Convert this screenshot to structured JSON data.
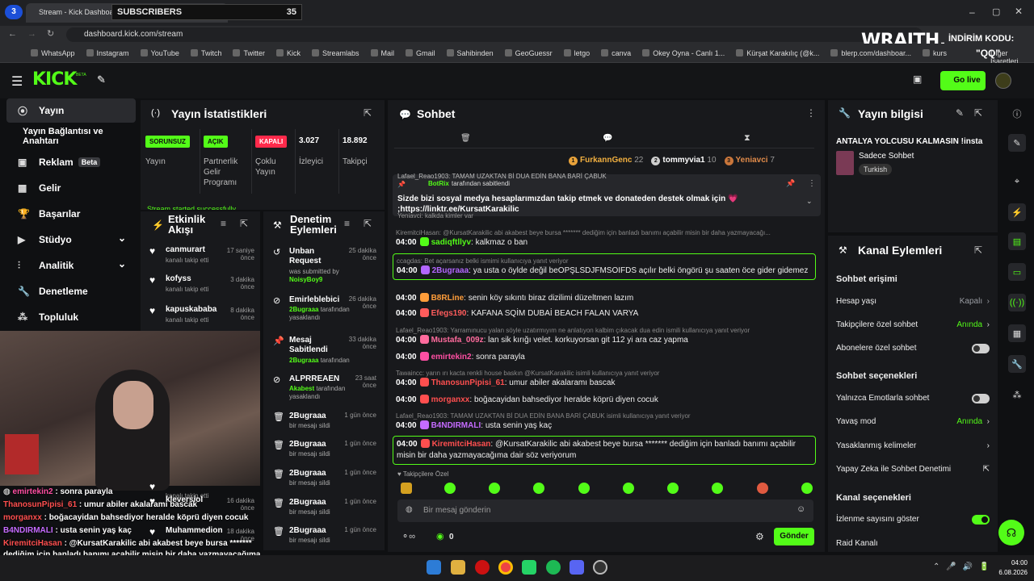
{
  "browser": {
    "tab_title": "Stream - Kick Dashboard",
    "tab_count": "3",
    "url": "dashboard.kick.com/stream",
    "bookmarks": [
      "WhatsApp",
      "Instagram",
      "YouTube",
      "Twitch",
      "Twitter",
      "Kick",
      "Streamlabs",
      "Mail",
      "Gmail",
      "Sahibinden",
      "GeoGuessr",
      "letgo",
      "canva",
      "Okey Oyna - Canlı 1...",
      "Kürşat Karakılıç (@k...",
      "blerp.com/dashboar...",
      "kurs"
    ],
    "other_bookmarks": "Diğer İşaretleri"
  },
  "overlay": {
    "subscribers_label": "SUBSCRIBERS",
    "subscribers_count": "35",
    "sponsor": "WRAITH.",
    "sponsor_code_label": "İNDİRİM KODU:",
    "sponsor_code": "\"QQ\""
  },
  "app": {
    "logo": "KICK",
    "logo_beta": "BETA",
    "go_live": "Go live"
  },
  "nav": {
    "items": [
      {
        "label": "Yayın",
        "icon": "broadcast-icon"
      },
      {
        "label": "Yayın Bağlantısı ve Anahtarı",
        "icon": ""
      },
      {
        "label": "Reklam",
        "icon": "ad-icon",
        "badge": "Beta"
      },
      {
        "label": "Gelir",
        "icon": "grid-icon"
      },
      {
        "label": "Başarılar",
        "icon": "trophy-icon"
      },
      {
        "label": "Stüdyo",
        "icon": "studio-icon"
      },
      {
        "label": "Analitik",
        "icon": "analytics-icon"
      },
      {
        "label": "Denetleme",
        "icon": "wrench-icon"
      },
      {
        "label": "Topluluk",
        "icon": "community-icon"
      }
    ]
  },
  "stats": {
    "title": "Yayın İstatistikleri",
    "cols": [
      {
        "pill": "SORUNSUZ",
        "label": "Yayın"
      },
      {
        "pill": "AÇIK",
        "label": "Partnerlik Gelir Programı"
      },
      {
        "pill": "KAPALI",
        "label": "Çoklu Yayın"
      },
      {
        "value": "3.027",
        "label": "İzleyici"
      },
      {
        "value": "18.892",
        "label": "Takipçi"
      }
    ],
    "banner": "Stream started successfully"
  },
  "activity": {
    "title": "Etkinlik Akışı",
    "items": [
      {
        "name": "canmurart",
        "sub": "kanalı takip etti",
        "time": "17 saniye önce"
      },
      {
        "name": "kofyss",
        "sub": "kanalı takip etti",
        "time": "3 dakika önce"
      },
      {
        "name": "kapuskababa",
        "sub": "kanalı takip etti",
        "time": "8 dakika önce"
      },
      {
        "name": "",
        "sub": "kanalı takip etti",
        "time": ""
      },
      {
        "name": "kleversiol",
        "sub": "",
        "time": "16 dakika önce"
      },
      {
        "name": "Muhammedion",
        "sub": "",
        "time": "18 dakika önce"
      }
    ]
  },
  "moderation": {
    "title": "Denetim Eylemleri",
    "items": [
      {
        "name": "Unban Request",
        "sub": "was submitted by",
        "user": "NoisyBoy9",
        "time": "25 dakika önce"
      },
      {
        "name": "Emirleblebici",
        "user": "2Bugraaa",
        "sub": "tarafından yasaklandı",
        "time": "26 dakika önce"
      },
      {
        "name": "Mesaj Sabitlendi",
        "user": "2Bugraaa",
        "sub": "tarafından",
        "time": "33 dakika önce"
      },
      {
        "name": "ALPRREAEN",
        "user": "Akabest",
        "sub": "tarafından yasaklandı",
        "time": "23 saat önce"
      },
      {
        "name": "2Bugraaa",
        "sub": "bir mesajı sildi",
        "time": "1 gün önce"
      },
      {
        "name": "2Bugraaa",
        "sub": "bir mesajı sildi",
        "time": "1 gün önce"
      },
      {
        "name": "2Bugraaa",
        "sub": "bir mesajı sildi",
        "time": "1 gün önce"
      },
      {
        "name": "2Bugraaa",
        "sub": "bir mesajı sildi",
        "time": "1 gün önce"
      },
      {
        "name": "2Bugraaa",
        "sub": "bir mesajı sildi",
        "time": "1 gün önce"
      }
    ]
  },
  "chat": {
    "title": "Sohbet",
    "leaders": [
      {
        "name": "FurkannGenc",
        "count": "22",
        "rank": "1"
      },
      {
        "name": "tommyvia1",
        "count": "10",
        "rank": "2"
      },
      {
        "name": "Yeniavci",
        "count": "7",
        "rank": "3"
      }
    ],
    "pinned": {
      "by": "BotRix",
      "by_suffix": "tarafından sabitlendi",
      "text": "Sizde bizi sosyal medya hesaplarımızdan takip etmek ve donateden destek olmak için 💗 ;https://linktr.ee/KursatKarakilic",
      "behind": "Lafael_Reao1903: TAMAM UZAKTAN Bİ DUA EDİN BANA BARİ ÇABUK",
      "behind2": "Yeniavci: kalkda kimler var"
    },
    "messages": [
      {
        "reply": "KiremitciHasan: @KursatKarakilic abi akabest beye bursa ******* dediğim için banladı banımı açabilir misin bir daha yazmayacağı...",
        "time": "04:00",
        "user": "sadiqftllyv",
        "color": "#53fc18",
        "text": "kalkmaz o ban"
      },
      {
        "reply": "ccagdas: Bet açarsanız belki ismimi kullanıcıya yanıt veriyor",
        "time": "04:00",
        "user": "2Bugraaa",
        "color": "#b366ff",
        "text": "ya usta o öylde değil beOPŞLSDJFMSOIFDS açılır belki öngörü şu saaten öce gider gidemez",
        "highlight": true
      },
      {
        "time": "04:00",
        "user": "B8RLine",
        "color": "#ff9d3a",
        "text": "senin köy sıkıntı biraz dizilimi düzeltmen lazım"
      },
      {
        "time": "04:00",
        "user": "Efegs190",
        "color": "#ff5c5c",
        "text": "KAFANA SQİM DUBAİ BEACH FALAN VARYA"
      },
      {
        "reply": "Lafael_Reao1903: Yarramınucu yalan söyle uzatırmıyım ne anlatıyon kalbim çıkacak dua edin ismili kullanıcıya yanıt veriyor",
        "time": "04:00",
        "user": "Mustafa_009z",
        "color": "#ff6b9d",
        "text": "lan sik kırığı velet. korkuyorsan git 112 yi ara caz yapma"
      },
      {
        "time": "04:00",
        "user": "emirtekin2",
        "color": "#ff4fa3",
        "text": "sonra parayla"
      },
      {
        "reply": "Tawaincc: yarın ırı kacta renkli house baskın @KursatKarakilic isimli kullanıcıya yanıt veriyor",
        "time": "04:00",
        "user": "ThanosunPipisi_61",
        "color": "#ff4f4f",
        "text": "umur abiler akalaramı bascak"
      },
      {
        "time": "04:00",
        "user": "morganxx",
        "color": "#ff4f4f",
        "text": "boğacayidan bahsediyor heralde köprü diyen cocuk"
      },
      {
        "reply": "Lafael_Reao1903: TAMAM UZAKTAN Bİ DUA EDİN BANA BARİ ÇABUK isimli kullanıcıya yanıt veriyor",
        "time": "04:00",
        "user": "B4NDIRMALI",
        "color": "#c56bff",
        "text": "usta senin yaş kaç"
      },
      {
        "time": "04:00",
        "user": "KiremitciHasan",
        "color": "#ff4f4f",
        "text": "@KursatKarakilic abi akabest beye bursa ******* dediğim için banladı banımı açabilir misin bir daha yazmayacağıma dair söz veriyorum",
        "highlight": true
      }
    ],
    "followers_only": "Takipçilere Özel",
    "input_placeholder": "Bir mesaj gönderin",
    "points": "0",
    "send": "Gönder"
  },
  "stream_info": {
    "title": "Yayın bilgisi",
    "stream_title": "ANTALYA YOLCUSU KALMASIN !insta",
    "category": "Sadece Sohbet",
    "language": "Turkish"
  },
  "channel_actions": {
    "title": "Kanal Eylemleri",
    "chat_access": "Sohbet erişimi",
    "account_age": "Hesap yaşı",
    "account_age_val": "Kapalı",
    "followers_only": "Takipçilere özel sohbet",
    "followers_only_val": "Anında",
    "subs_only": "Abonelere özel sohbet",
    "chat_options": "Sohbet seçenekleri",
    "emotes_only": "Yalnızca Emotlarla sohbet",
    "slow_mode": "Yavaş mod",
    "slow_mode_val": "Anında",
    "banned_words": "Yasaklanmış kelimeler",
    "ai_moderation": "Yapay Zeka ile Sohbet Denetimi",
    "channel_options": "Kanal seçenekleri",
    "show_viewers": "İzlenme sayısını göster",
    "raid": "Raid Kanalı"
  },
  "overlay_chat": [
    {
      "user": "emirtekin2",
      "color": "#ff4fa3",
      "text": "sonra parayla"
    },
    {
      "user": "ThanosunPipisi_61",
      "color": "#ff4f4f",
      "text": "umur abiler akalaramı bascak"
    },
    {
      "user": "morganxx",
      "color": "#ff4f4f",
      "text": "boğacayidan bahsediyor heralde köprü diyen cocuk"
    },
    {
      "user": "B4NDIRMALI",
      "color": "#c56bff",
      "text": "usta senin yaş kaç"
    },
    {
      "user": "KiremitciHasan",
      "color": "#ff4f4f",
      "text": "@KursatKarakilic abi akabest beye bursa ******* dediğim için banladı banımı açabilir misin bir daha yazmayacağıma dair söz veriyorum"
    }
  ],
  "taskbar": {
    "time": "04:00",
    "date": "6.08.2026"
  },
  "colors": {
    "accent": "#53fc18",
    "panel": "#18191c",
    "bg": "#0f1012"
  }
}
